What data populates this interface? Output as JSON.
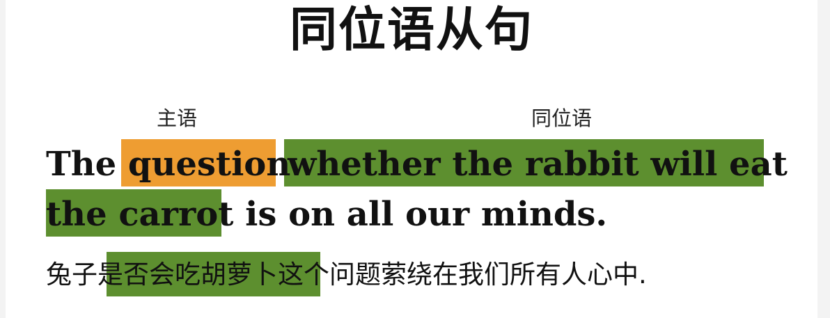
{
  "title": "同位语从句",
  "labels": {
    "subject": "主语",
    "appositive": "同位语"
  },
  "english_sentence": {
    "line1_plain": "The ",
    "line1_subject": "question",
    "line1_appositive": "whether the rabbit will eat",
    "line2_appositive": "the carrot",
    "line2_rest": " is on all our minds."
  },
  "chinese_sentence": {
    "before": "兔子",
    "highlighted": "是否会吃胡萝卜",
    "after": "这个问题萦绕在我们所有人心中."
  },
  "colors": {
    "subject_highlight": "#ee9d32",
    "appositive_highlight": "#5d8f2f"
  }
}
